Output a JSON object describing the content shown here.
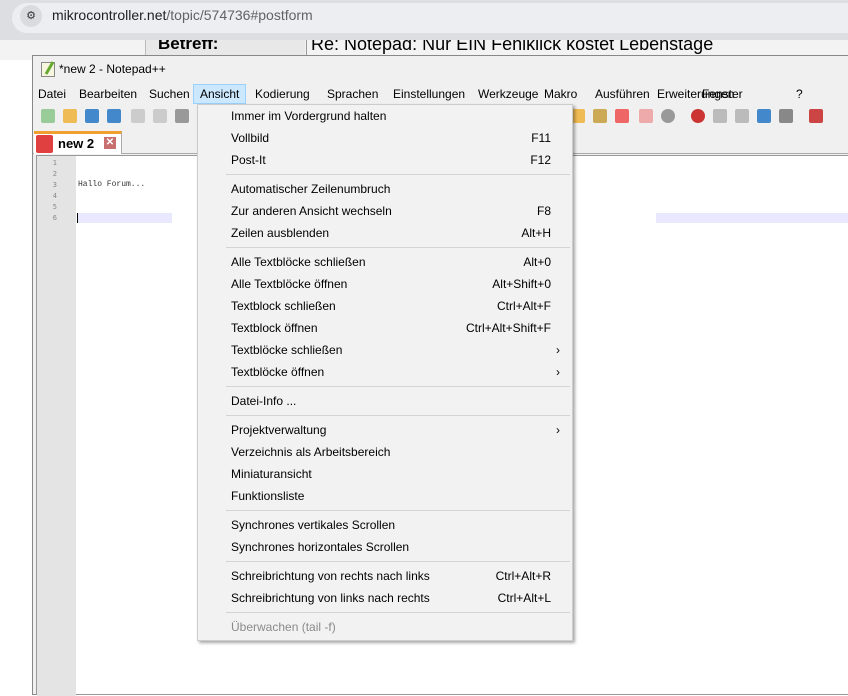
{
  "browser": {
    "url_host": "mikrocontroller.net",
    "url_path": "/topic/574736#postform"
  },
  "web": {
    "label": "Betreff:",
    "subject": "Re: Notepad: Nur EIN Fehlklick kostet Lebenstage"
  },
  "window": {
    "title": "*new 2 - Notepad++"
  },
  "menubar": [
    "Datei",
    "Bearbeiten",
    "Suchen",
    "Ansicht",
    "Kodierung",
    "Sprachen",
    "Einstellungen",
    "Werkzeuge",
    "Makro",
    "Ausführen",
    "Erweiterungen",
    "Fenster",
    "?"
  ],
  "tab": {
    "label": "new 2"
  },
  "editor": {
    "line_numbers": [
      "1",
      "2",
      "3",
      "4",
      "5",
      "6"
    ],
    "lines": [
      "",
      "",
      "Hallo Forum...",
      "",
      "",
      ""
    ]
  },
  "menu": {
    "groups": [
      [
        {
          "label": "Immer im Vordergrund halten",
          "shortcut": ""
        },
        {
          "label": "Vollbild",
          "shortcut": "F11"
        },
        {
          "label": "Post-It",
          "shortcut": "F12"
        }
      ],
      [
        {
          "label": "Automatischer Zeilenumbruch",
          "shortcut": ""
        },
        {
          "label": "Zur anderen Ansicht wechseln",
          "shortcut": "F8"
        },
        {
          "label": "Zeilen ausblenden",
          "shortcut": "Alt+H"
        }
      ],
      [
        {
          "label": "Alle Textblöcke schließen",
          "shortcut": "Alt+0"
        },
        {
          "label": "Alle Textblöcke öffnen",
          "shortcut": "Alt+Shift+0"
        },
        {
          "label": "Textblock schließen",
          "shortcut": "Ctrl+Alt+F"
        },
        {
          "label": "Textblock öffnen",
          "shortcut": "Ctrl+Alt+Shift+F"
        },
        {
          "label": "Textblöcke schließen",
          "shortcut": "",
          "submenu": "›"
        },
        {
          "label": "Textblöcke öffnen",
          "shortcut": "",
          "submenu": "›"
        }
      ],
      [
        {
          "label": "Datei-Info ...",
          "shortcut": ""
        }
      ],
      [
        {
          "label": "Projektverwaltung",
          "shortcut": "",
          "submenu": "›"
        },
        {
          "label": "Verzeichnis als Arbeitsbereich",
          "shortcut": ""
        },
        {
          "label": "Miniaturansicht",
          "shortcut": ""
        },
        {
          "label": "Funktionsliste",
          "shortcut": ""
        }
      ],
      [
        {
          "label": "Synchrones vertikales Scrollen",
          "shortcut": ""
        },
        {
          "label": "Synchrones horizontales Scrollen",
          "shortcut": ""
        }
      ],
      [
        {
          "label": "Schreibrichtung von rechts nach links",
          "shortcut": "Ctrl+Alt+R"
        },
        {
          "label": "Schreibrichtung von links nach rechts",
          "shortcut": "Ctrl+Alt+L"
        }
      ],
      [
        {
          "label": "Überwachen (tail -f)",
          "shortcut": "",
          "disabled": true
        }
      ]
    ]
  }
}
